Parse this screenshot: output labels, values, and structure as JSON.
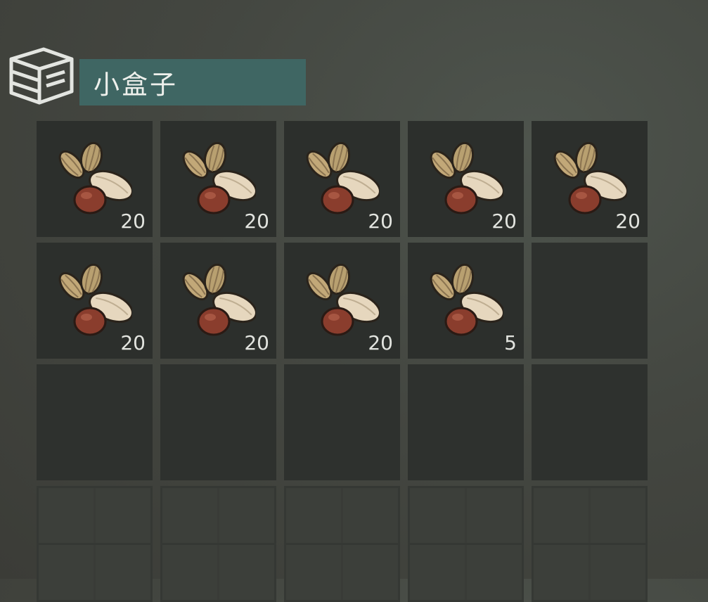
{
  "container": {
    "icon": "crate-icon",
    "title": "小盒子"
  },
  "slots": [
    {
      "item": "seeds-icon",
      "count": "20"
    },
    {
      "item": "seeds-icon",
      "count": "20"
    },
    {
      "item": "seeds-icon",
      "count": "20"
    },
    {
      "item": "seeds-icon",
      "count": "20"
    },
    {
      "item": "seeds-icon",
      "count": "20"
    },
    {
      "item": "seeds-icon",
      "count": "20"
    },
    {
      "item": "seeds-icon",
      "count": "20"
    },
    {
      "item": "seeds-icon",
      "count": "20"
    },
    {
      "item": "seeds-icon",
      "count": "5"
    },
    {
      "item": null,
      "count": null
    },
    {
      "item": null,
      "count": null
    },
    {
      "item": null,
      "count": null
    },
    {
      "item": null,
      "count": null
    },
    {
      "item": null,
      "count": null
    },
    {
      "item": null,
      "count": null
    },
    {
      "item": null,
      "count": null,
      "locked": true
    },
    {
      "item": null,
      "count": null,
      "locked": true
    },
    {
      "item": null,
      "count": null,
      "locked": true
    },
    {
      "item": null,
      "count": null,
      "locked": true
    },
    {
      "item": null,
      "count": null,
      "locked": true
    }
  ],
  "colors": {
    "title_bar": "#3f6663",
    "slot_bg": "#2c2f2c",
    "count_text": "#e2e4df"
  }
}
